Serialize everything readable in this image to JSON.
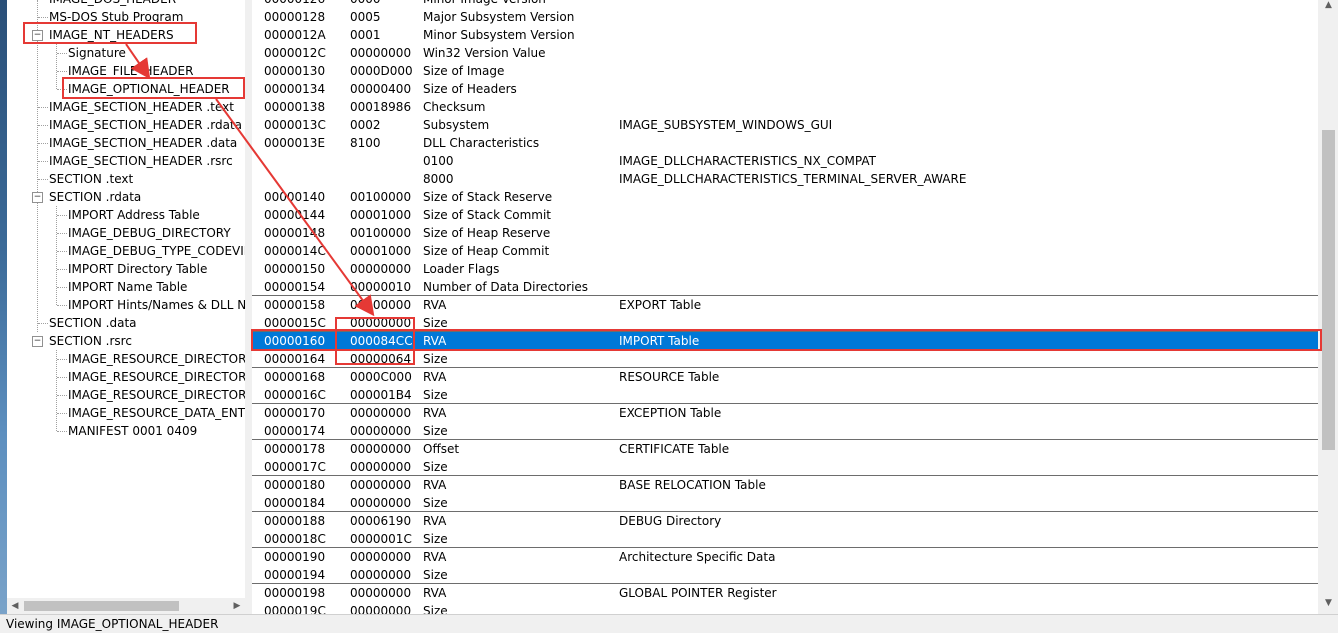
{
  "colors": {
    "selection": "#0078d7",
    "annotation": "#e53935"
  },
  "tree": {
    "nodes": [
      {
        "label": "IMAGE_DOS_HEADER"
      },
      {
        "label": "MS-DOS Stub Program"
      },
      {
        "label": "IMAGE_NT_HEADERS"
      },
      {
        "label": "Signature"
      },
      {
        "label": "IMAGE_FILE_HEADER"
      },
      {
        "label": "IMAGE_OPTIONAL_HEADER"
      },
      {
        "label": "IMAGE_SECTION_HEADER .text"
      },
      {
        "label": "IMAGE_SECTION_HEADER .rdata"
      },
      {
        "label": "IMAGE_SECTION_HEADER .data"
      },
      {
        "label": "IMAGE_SECTION_HEADER .rsrc"
      },
      {
        "label": "SECTION .text"
      },
      {
        "label": "SECTION .rdata"
      },
      {
        "label": "IMPORT Address Table"
      },
      {
        "label": "IMAGE_DEBUG_DIRECTORY"
      },
      {
        "label": "IMAGE_DEBUG_TYPE_CODEVIEW"
      },
      {
        "label": "IMPORT Directory Table"
      },
      {
        "label": "IMPORT Name Table"
      },
      {
        "label": "IMPORT Hints/Names & DLL Names"
      },
      {
        "label": "SECTION .data"
      },
      {
        "label": "SECTION .rsrc"
      },
      {
        "label": "IMAGE_RESOURCE_DIRECTORY"
      },
      {
        "label": "IMAGE_RESOURCE_DIRECTORY"
      },
      {
        "label": "IMAGE_RESOURCE_DIRECTORY"
      },
      {
        "label": "IMAGE_RESOURCE_DATA_ENTRY"
      },
      {
        "label": "MANIFEST  0001  0409"
      }
    ]
  },
  "grid": {
    "rows": [
      {
        "offset": "00000126",
        "data": "0000",
        "desc": "Minor Image Version",
        "value": ""
      },
      {
        "offset": "00000128",
        "data": "0005",
        "desc": "Major Subsystem Version",
        "value": ""
      },
      {
        "offset": "0000012A",
        "data": "0001",
        "desc": "Minor Subsystem Version",
        "value": ""
      },
      {
        "offset": "0000012C",
        "data": "00000000",
        "desc": "Win32 Version Value",
        "value": ""
      },
      {
        "offset": "00000130",
        "data": "0000D000",
        "desc": "Size of Image",
        "value": ""
      },
      {
        "offset": "00000134",
        "data": "00000400",
        "desc": "Size of Headers",
        "value": ""
      },
      {
        "offset": "00000138",
        "data": "00018986",
        "desc": "Checksum",
        "value": ""
      },
      {
        "offset": "0000013C",
        "data": "0002",
        "desc": "Subsystem",
        "value": "IMAGE_SUBSYSTEM_WINDOWS_GUI"
      },
      {
        "offset": "0000013E",
        "data": "8100",
        "desc": "DLL Characteristics",
        "value": ""
      },
      {
        "offset": "",
        "data": "",
        "desc": "0100",
        "value": "IMAGE_DLLCHARACTERISTICS_NX_COMPAT"
      },
      {
        "offset": "",
        "data": "",
        "desc": "8000",
        "value": "IMAGE_DLLCHARACTERISTICS_TERMINAL_SERVER_AWARE"
      },
      {
        "offset": "00000140",
        "data": "00100000",
        "desc": "Size of Stack Reserve",
        "value": ""
      },
      {
        "offset": "00000144",
        "data": "00001000",
        "desc": "Size of Stack Commit",
        "value": ""
      },
      {
        "offset": "00000148",
        "data": "00100000",
        "desc": "Size of Heap Reserve",
        "value": ""
      },
      {
        "offset": "0000014C",
        "data": "00001000",
        "desc": "Size of Heap Commit",
        "value": ""
      },
      {
        "offset": "00000150",
        "data": "00000000",
        "desc": "Loader Flags",
        "value": ""
      },
      {
        "offset": "00000154",
        "data": "00000010",
        "desc": "Number of Data Directories",
        "value": ""
      },
      {
        "offset": "00000158",
        "data": "00000000",
        "desc": "RVA",
        "value": "EXPORT Table"
      },
      {
        "offset": "0000015C",
        "data": "00000000",
        "desc": "Size",
        "value": ""
      },
      {
        "offset": "00000160",
        "data": "000084CC",
        "desc": "RVA",
        "value": "IMPORT Table",
        "selected": true
      },
      {
        "offset": "00000164",
        "data": "00000064",
        "desc": "Size",
        "value": ""
      },
      {
        "offset": "00000168",
        "data": "0000C000",
        "desc": "RVA",
        "value": "RESOURCE Table"
      },
      {
        "offset": "0000016C",
        "data": "000001B4",
        "desc": "Size",
        "value": ""
      },
      {
        "offset": "00000170",
        "data": "00000000",
        "desc": "RVA",
        "value": "EXCEPTION Table"
      },
      {
        "offset": "00000174",
        "data": "00000000",
        "desc": "Size",
        "value": ""
      },
      {
        "offset": "00000178",
        "data": "00000000",
        "desc": "Offset",
        "value": "CERTIFICATE Table"
      },
      {
        "offset": "0000017C",
        "data": "00000000",
        "desc": "Size",
        "value": ""
      },
      {
        "offset": "00000180",
        "data": "00000000",
        "desc": "RVA",
        "value": "BASE RELOCATION Table"
      },
      {
        "offset": "00000184",
        "data": "00000000",
        "desc": "Size",
        "value": ""
      },
      {
        "offset": "00000188",
        "data": "00006190",
        "desc": "RVA",
        "value": "DEBUG Directory"
      },
      {
        "offset": "0000018C",
        "data": "0000001C",
        "desc": "Size",
        "value": ""
      },
      {
        "offset": "00000190",
        "data": "00000000",
        "desc": "RVA",
        "value": "Architecture Specific Data"
      },
      {
        "offset": "00000194",
        "data": "00000000",
        "desc": "Size",
        "value": ""
      },
      {
        "offset": "00000198",
        "data": "00000000",
        "desc": "RVA",
        "value": "GLOBAL POINTER Register"
      },
      {
        "offset": "0000019C",
        "data": "00000000",
        "desc": "Size",
        "value": ""
      }
    ]
  },
  "status": {
    "text": "Viewing IMAGE_OPTIONAL_HEADER"
  }
}
